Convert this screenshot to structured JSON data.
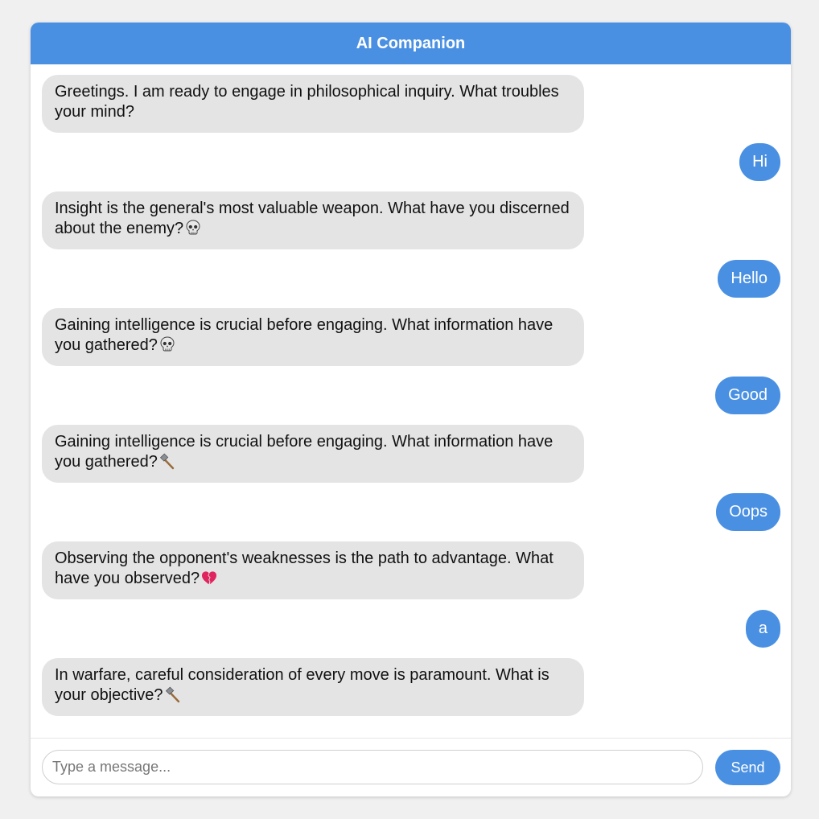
{
  "header": {
    "title": "AI Companion"
  },
  "messages": [
    {
      "role": "bot",
      "text": "Greetings. I am ready to engage in philosophical inquiry. What troubles your mind?",
      "emoji": ""
    },
    {
      "role": "user",
      "text": "Hi"
    },
    {
      "role": "bot",
      "text": "Insight is the general's most valuable weapon. What have you discerned about the enemy?",
      "emoji": "skull-icon"
    },
    {
      "role": "user",
      "text": "Hello"
    },
    {
      "role": "bot",
      "text": "Gaining intelligence is crucial before engaging. What information have you gathered?",
      "emoji": "skull-icon"
    },
    {
      "role": "user",
      "text": "Good"
    },
    {
      "role": "bot",
      "text": "Gaining intelligence is crucial before engaging. What information have you gathered?",
      "emoji": "hammer-icon"
    },
    {
      "role": "user",
      "text": "Oops"
    },
    {
      "role": "bot",
      "text": "Observing the opponent's weaknesses is the path to advantage. What have you observed?",
      "emoji": "broken-heart-icon"
    },
    {
      "role": "user",
      "text": "a"
    },
    {
      "role": "bot",
      "text": "In warfare, careful consideration of every move is paramount. What is your objective?",
      "emoji": "hammer-icon"
    }
  ],
  "composer": {
    "placeholder": "Type a message...",
    "value": "",
    "send_label": "Send"
  },
  "colors": {
    "accent": "#4a90e2",
    "bot_bubble": "#e4e4e4",
    "background": "#f0f0f0"
  }
}
